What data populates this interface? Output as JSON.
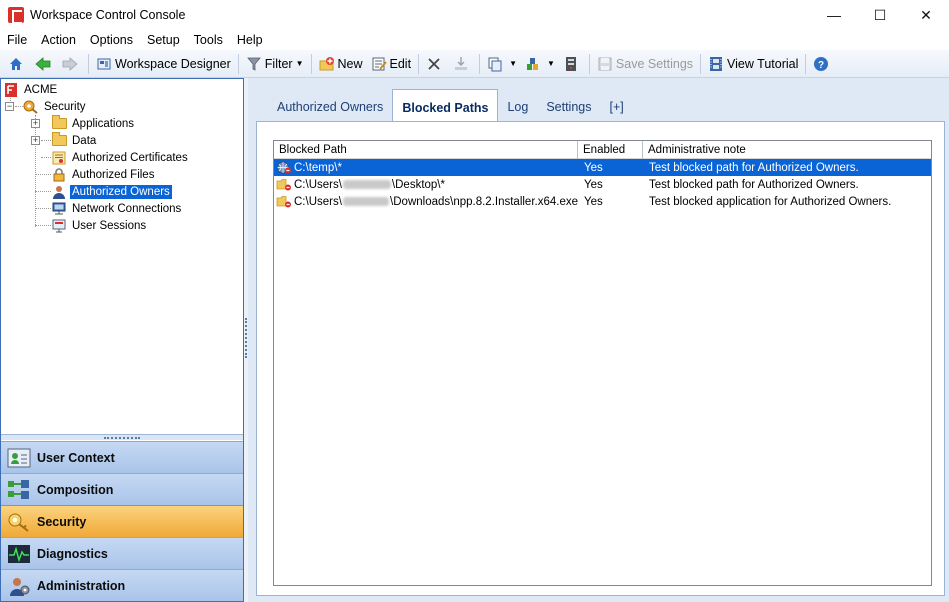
{
  "window": {
    "title": "Workspace Control Console",
    "controls": {
      "minimize": "—",
      "maximize": "☐",
      "close": "✕"
    }
  },
  "menu": [
    "File",
    "Action",
    "Options",
    "Setup",
    "Tools",
    "Help"
  ],
  "toolbar": {
    "workspace_designer": "Workspace Designer",
    "filter": "Filter",
    "new": "New",
    "edit": "Edit",
    "save_settings": "Save Settings",
    "view_tutorial": "View Tutorial"
  },
  "tree": {
    "root": "ACME",
    "security": "Security",
    "items": [
      {
        "label": "Applications",
        "icon": "folder-icon",
        "expandable": true
      },
      {
        "label": "Data",
        "icon": "folder-icon",
        "expandable": true
      },
      {
        "label": "Authorized Certificates",
        "icon": "certificate-icon",
        "expandable": false
      },
      {
        "label": "Authorized Files",
        "icon": "lock-icon",
        "expandable": false
      },
      {
        "label": "Authorized Owners",
        "icon": "user-icon",
        "expandable": false,
        "selected": true
      },
      {
        "label": "Network Connections",
        "icon": "network-icon",
        "expandable": false
      },
      {
        "label": "User Sessions",
        "icon": "session-icon",
        "expandable": false
      }
    ]
  },
  "nav": [
    {
      "label": "User Context",
      "icon": "user-context-icon"
    },
    {
      "label": "Composition",
      "icon": "composition-icon"
    },
    {
      "label": "Security",
      "icon": "security-keys-icon",
      "active": true
    },
    {
      "label": "Diagnostics",
      "icon": "diagnostics-icon"
    },
    {
      "label": "Administration",
      "icon": "administration-icon"
    }
  ],
  "tabs": [
    {
      "label": "Authorized Owners"
    },
    {
      "label": "Blocked Paths",
      "active": true
    },
    {
      "label": "Log"
    },
    {
      "label": "Settings"
    },
    {
      "label": "[+]"
    }
  ],
  "list": {
    "columns": [
      "Blocked Path",
      "Enabled",
      "Administrative note"
    ],
    "rows": [
      {
        "path_prefix": "C:\\temp\\*",
        "path_suffix": "",
        "redacted": false,
        "enabled": "Yes",
        "note": "Test blocked path for Authorized Owners.",
        "selected": true,
        "icon": "blocked-network-path-icon"
      },
      {
        "path_prefix": "C:\\Users\\",
        "path_suffix": "\\Desktop\\*",
        "redacted": true,
        "enabled": "Yes",
        "note": "Test blocked path for Authorized Owners.",
        "selected": false,
        "icon": "blocked-folder-icon"
      },
      {
        "path_prefix": "C:\\Users\\",
        "path_suffix": "\\Downloads\\npp.8.2.Installer.x64.exe",
        "redacted": true,
        "enabled": "Yes",
        "note": "Test blocked application for Authorized Owners.",
        "selected": false,
        "icon": "blocked-folder-icon"
      }
    ]
  },
  "colors": {
    "selection": "#0a64d6",
    "nav_active": "#f0a937",
    "nav_inactive": "#b6cdee",
    "panel_bg": "#dfe9f6",
    "brand_red": "#d9302c"
  }
}
